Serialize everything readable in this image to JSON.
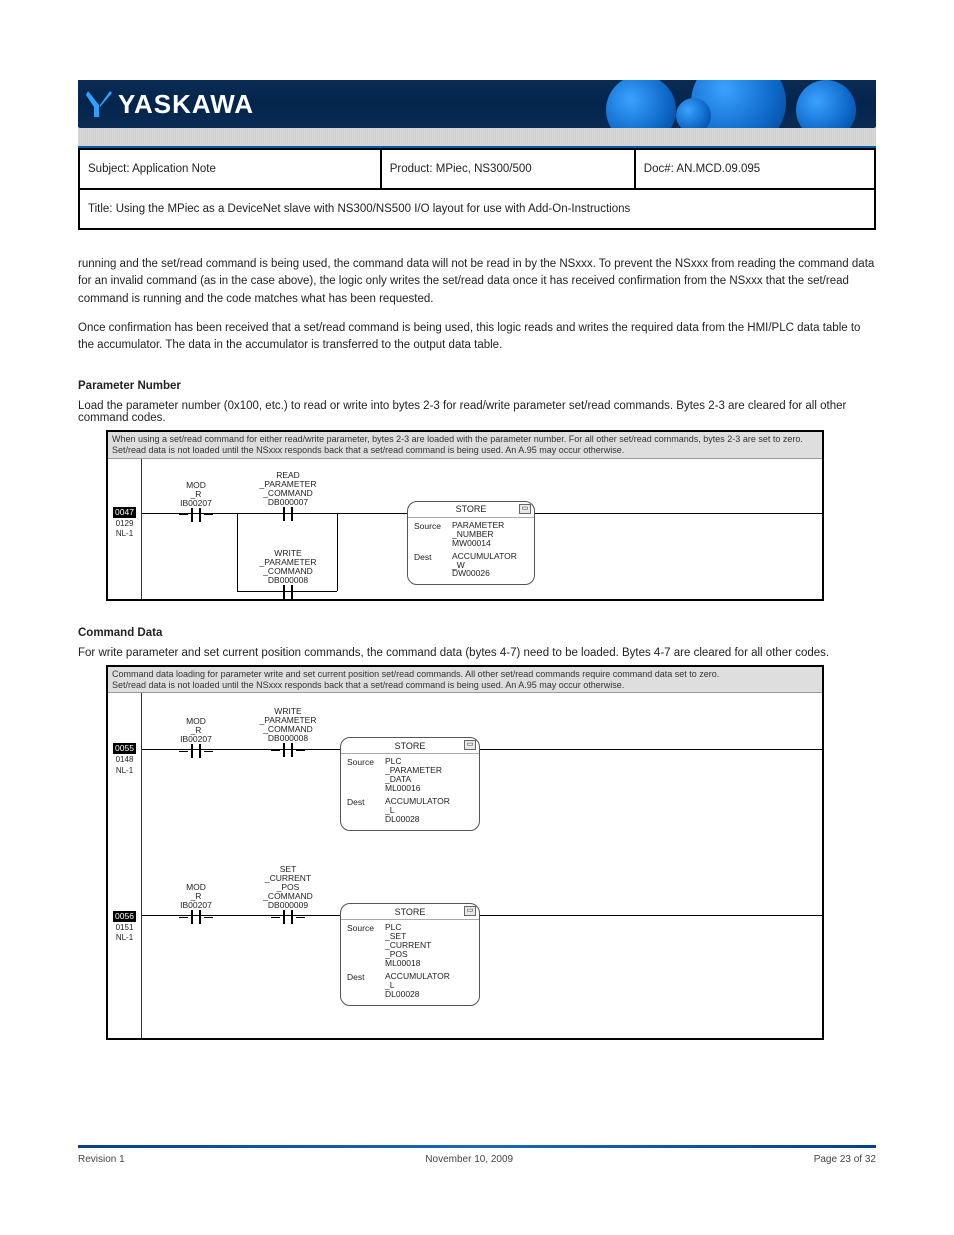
{
  "brand": "YASKAWA",
  "header": {
    "subject": "Subject: Application Note",
    "product": "Product: MPiec, NS300/500",
    "docnum": "Doc#:  AN.MCD.09.095",
    "title": "Title: Using the MPiec as a DeviceNet slave with NS300/NS500 I/O layout for use with Add-On-Instructions"
  },
  "body": {
    "p1": "running and the set/read command is being used, the command data will not be read in by the NSxxx.  To prevent the NSxxx from reading the command data for an invalid command (as in the case above), the logic only writes the set/read data once it has received confirmation from the NSxxx that the set/read command is running and the code matches what has been requested.",
    "p2": "Once confirmation has been received that a set/read command is being used, this logic reads and writes the required data from the HMI/PLC data table to the accumulator.  The data in the accumulator is transferred to the output data table."
  },
  "label_param_number": "Parameter Number",
  "caption_param_number": "Load the parameter number (0x100, etc.) to read or write into bytes 2-3 for read/write parameter set/read commands.  Bytes 2-3 are cleared for all other command codes.",
  "label_command_data": "Command Data",
  "caption_command_data": "For write parameter and set current position commands, the command data (bytes 4-7) need to be loaded. Bytes 4-7 are cleared for all other codes.",
  "fig1": {
    "comment_l1": "When using a set/read command for either read/write parameter, bytes 2-3 are loaded with the parameter number.  For all other set/read commands, bytes 2-3 are set to zero.",
    "comment_l2": "Set/read data is not loaded until the NSxxx responds back that a set/read command is being used.  An A.95 may occur otherwise.",
    "rung": {
      "step": "0047",
      "line": "0129",
      "nl": "NL-1"
    },
    "contact_mod": {
      "l1": "MOD",
      "l2": "_R",
      "l3": "IB00207"
    },
    "contact_read": {
      "l1": "READ",
      "l2": "_PARAMETER",
      "l3": "_COMMAND",
      "l4": "DB000007"
    },
    "contact_write": {
      "l1": "WRITE",
      "l2": "_PARAMETER",
      "l3": "_COMMAND",
      "l4": "DB000008"
    },
    "store": {
      "title": "STORE",
      "src_k": "Source",
      "src_l1": "PARAMETER",
      "src_l2": "_NUMBER",
      "src_l3": "MW00014",
      "dst_k": "Dest",
      "dst_l1": "ACCUMULATOR",
      "dst_l2": "_W",
      "dst_l3": "DW00026"
    }
  },
  "fig2": {
    "comment_l1": "Command data loading for parameter write and set current position set/read commands.  All other set/read commands require command data set to zero.",
    "comment_l2": "Set/read data is not loaded until the NSxxx responds back that a set/read command is being used.  An A.95 may occur otherwise.",
    "rung1": {
      "step": "0055",
      "line": "0148",
      "nl": "NL-1"
    },
    "rung2": {
      "step": "0056",
      "line": "0151",
      "nl": "NL-1"
    },
    "contact_mod": {
      "l1": "MOD",
      "l2": "_R",
      "l3": "IB00207"
    },
    "contact_write": {
      "l1": "WRITE",
      "l2": "_PARAMETER",
      "l3": "_COMMAND",
      "l4": "DB000008"
    },
    "store1": {
      "title": "STORE",
      "src_k": "Source",
      "src_l1": "PLC",
      "src_l2": "_PARAMETER",
      "src_l3": "_DATA",
      "src_l4": "ML00016",
      "dst_k": "Dest",
      "dst_l1": "ACCUMULATOR",
      "dst_l2": "_L",
      "dst_l3": "DL00028"
    },
    "contact_set": {
      "l1": "SET",
      "l2": "_CURRENT",
      "l3": "_POS",
      "l4": "_COMMAND",
      "l5": "DB000009"
    },
    "store2": {
      "title": "STORE",
      "src_k": "Source",
      "src_l1": "PLC",
      "src_l2": "_SET",
      "src_l3": "_CURRENT",
      "src_l4": "_POS",
      "src_l5": "ML00018",
      "dst_k": "Dest",
      "dst_l1": "ACCUMULATOR",
      "dst_l2": "_L",
      "dst_l3": "DL00028"
    }
  },
  "footer": {
    "left": "Revision 1",
    "center": "November 10, 2009",
    "right": "Page 23 of 32"
  }
}
